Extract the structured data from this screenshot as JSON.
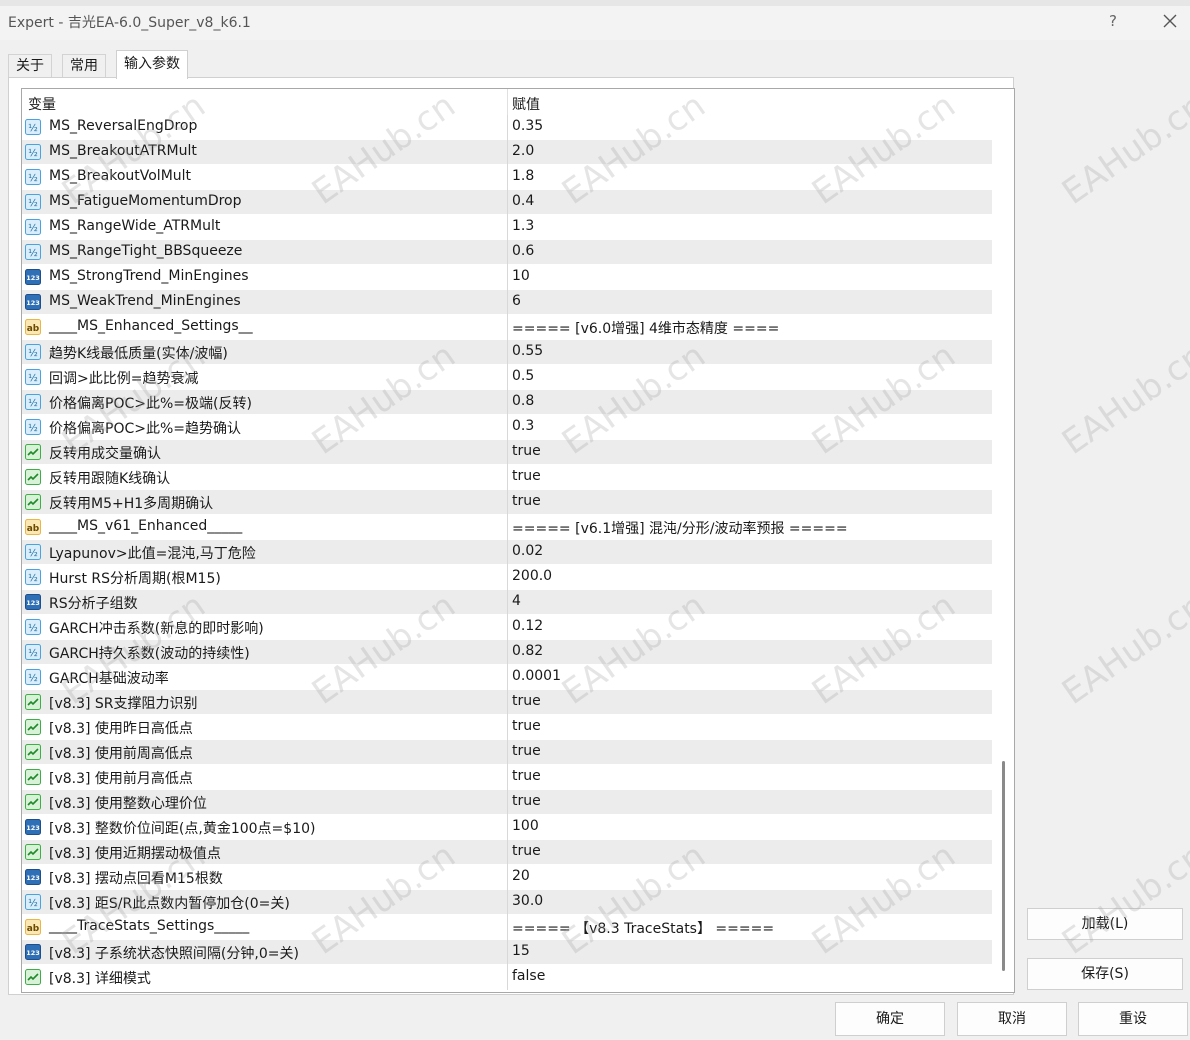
{
  "window": {
    "title": "Expert - 吉光EA-6.0_Super_v8_k6.1",
    "help_label": "?",
    "close_icon": "close-icon"
  },
  "tabs": [
    {
      "label": "关于",
      "active": false
    },
    {
      "label": "常用",
      "active": false
    },
    {
      "label": "输入参数",
      "active": true
    }
  ],
  "table": {
    "col_variable": "变量",
    "col_value": "赋值",
    "rows": [
      {
        "type": "double",
        "name": "MS_ReversalEngDrop",
        "value": "0.35"
      },
      {
        "type": "double",
        "name": "MS_BreakoutATRMult",
        "value": "2.0"
      },
      {
        "type": "double",
        "name": "MS_BreakoutVolMult",
        "value": "1.8"
      },
      {
        "type": "double",
        "name": "MS_FatigueMomentumDrop",
        "value": "0.4"
      },
      {
        "type": "double",
        "name": "MS_RangeWide_ATRMult",
        "value": "1.3"
      },
      {
        "type": "double",
        "name": "MS_RangeTight_BBSqueeze",
        "value": "0.6"
      },
      {
        "type": "int",
        "name": "MS_StrongTrend_MinEngines",
        "value": "10"
      },
      {
        "type": "int",
        "name": "MS_WeakTrend_MinEngines",
        "value": "6"
      },
      {
        "type": "string",
        "name": "____MS_Enhanced_Settings__",
        "value": "===== [v6.0增强] 4维市态精度 ===="
      },
      {
        "type": "double",
        "name": "趋势K线最低质量(实体/波幅)",
        "value": "0.55"
      },
      {
        "type": "double",
        "name": "回调>此比例=趋势衰减",
        "value": "0.5"
      },
      {
        "type": "double",
        "name": "价格偏离POC>此%=极端(反转)",
        "value": "0.8"
      },
      {
        "type": "double",
        "name": "价格偏离POC>此%=趋势确认",
        "value": "0.3"
      },
      {
        "type": "bool",
        "name": "反转用成交量确认",
        "value": "true"
      },
      {
        "type": "bool",
        "name": "反转用跟随K线确认",
        "value": "true"
      },
      {
        "type": "bool",
        "name": "反转用M5+H1多周期确认",
        "value": "true"
      },
      {
        "type": "string",
        "name": "____MS_v61_Enhanced_____",
        "value": "===== [v6.1增强] 混沌/分形/波动率预报 ====="
      },
      {
        "type": "double",
        "name": "Lyapunov>此值=混沌,马丁危险",
        "value": "0.02"
      },
      {
        "type": "double",
        "name": "Hurst RS分析周期(根M15)",
        "value": "200.0"
      },
      {
        "type": "int",
        "name": "RS分析子组数",
        "value": "4"
      },
      {
        "type": "double",
        "name": "GARCH冲击系数(新息的即时影响)",
        "value": "0.12"
      },
      {
        "type": "double",
        "name": "GARCH持久系数(波动的持续性)",
        "value": "0.82"
      },
      {
        "type": "double",
        "name": "GARCH基础波动率",
        "value": "0.0001"
      },
      {
        "type": "bool",
        "name": "[v8.3] SR支撑阻力识别",
        "value": "true"
      },
      {
        "type": "bool",
        "name": "[v8.3] 使用昨日高低点",
        "value": "true"
      },
      {
        "type": "bool",
        "name": "[v8.3] 使用前周高低点",
        "value": "true"
      },
      {
        "type": "bool",
        "name": "[v8.3] 使用前月高低点",
        "value": "true"
      },
      {
        "type": "bool",
        "name": "[v8.3] 使用整数心理价位",
        "value": "true"
      },
      {
        "type": "int",
        "name": "[v8.3] 整数价位间距(点,黄金100点=$10)",
        "value": "100"
      },
      {
        "type": "bool",
        "name": "[v8.3] 使用近期摆动极值点",
        "value": "true"
      },
      {
        "type": "int",
        "name": "[v8.3] 摆动点回看M15根数",
        "value": "20"
      },
      {
        "type": "double",
        "name": "[v8.3] 距S/R此点数内暂停加仓(0=关)",
        "value": "30.0"
      },
      {
        "type": "string",
        "name": "____TraceStats_Settings_____",
        "value": "===== 【v8.3 TraceStats】 ====="
      },
      {
        "type": "int",
        "name": "[v8.3] 子系统状态快照间隔(分钟,0=关)",
        "value": "15"
      },
      {
        "type": "bool",
        "name": "[v8.3] 详细模式",
        "value": "false"
      }
    ]
  },
  "icons": {
    "double": {
      "label": "½",
      "name": "double-type-icon"
    },
    "int": {
      "label": "123",
      "name": "integer-type-icon"
    },
    "string": {
      "label": "ab",
      "name": "string-type-icon"
    },
    "bool": {
      "label": "",
      "name": "boolean-type-icon"
    }
  },
  "buttons": {
    "load": "加载(L)",
    "save": "保存(S)",
    "ok": "确定",
    "cancel": "取消",
    "reset": "重设"
  },
  "watermark": "EAHub.cn",
  "colors": {
    "double_icon": "#4aa3df",
    "int_icon": "#2f6fb6",
    "string_icon": "#e8b64a",
    "bool_icon": "#3fae49"
  }
}
